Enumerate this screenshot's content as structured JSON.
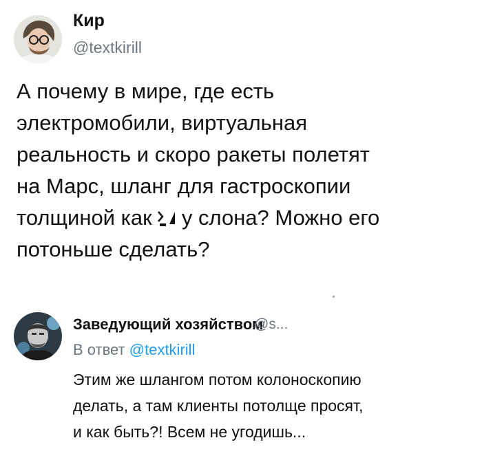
{
  "tweet": {
    "author_name": "Кир",
    "author_handle": "@textkirill",
    "text_lines": [
      "А почему в мире, где есть",
      "электромобили, виртуальная",
      "реальность и скоро ракеты полетят",
      "на Марс, шланг для гастроскопии",
      "толщиной как",
      "у слона? Можно его",
      "потоньше сделать?"
    ]
  },
  "reply": {
    "author_name": "Заведующий хозяйством",
    "author_handle": "@s...",
    "reply_prefix": "В ответ",
    "reply_mention": "@textkirill",
    "text_lines": [
      "Этим же шлангом потом колоноскопию",
      "делать, а там клиенты потолще просят,",
      "и как быть?! Всем не угодишь..."
    ]
  },
  "colors": {
    "text": "#111111",
    "secondary": "#6b7680",
    "mention": "#1d9bf0",
    "background": "#ffffff"
  }
}
